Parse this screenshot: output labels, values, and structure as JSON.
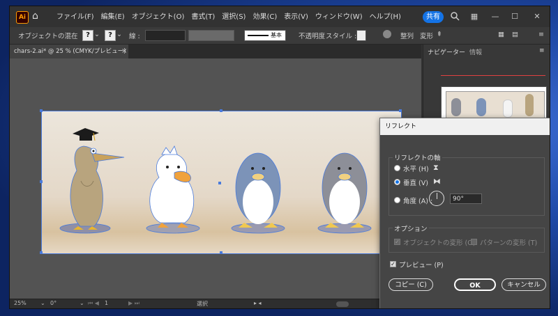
{
  "app": {
    "logo": "Ai",
    "menu": [
      "ファイル(F)",
      "編集(E)",
      "オブジェクト(O)",
      "書式(T)",
      "選択(S)",
      "効果(C)",
      "表示(V)",
      "ウィンドウ(W)",
      "ヘルプ(H)"
    ],
    "share_label": "共有"
  },
  "control_bar": {
    "mixed_label": "オブジェクトの混在",
    "stroke_label": "線 :",
    "stroke_style": "基本",
    "opacity_label": "不透明度",
    "style_label": "スタイル :",
    "align_label": "整列",
    "transform_label": "変形"
  },
  "document": {
    "tab_title": "chars-2.ai* @ 25 % (CMYK/プレビュー)",
    "tab_close": "×"
  },
  "status_bar": {
    "zoom": "25%",
    "rotation": "0°",
    "artboard_index": "1",
    "tool": "選択"
  },
  "panel": {
    "tabs": [
      "ナビゲーター",
      "情報"
    ]
  },
  "reflect_dialog": {
    "title": "リフレクト",
    "axis_group_label": "リフレクトの軸",
    "horizontal_label": "水平 (H)",
    "vertical_label": "垂直 (V)",
    "angle_label": "角度 (A) :",
    "angle_value": "90°",
    "selected_axis": "vertical",
    "options_group_label": "オプション",
    "transform_objects_label": "オブジェクトの変形 (O)",
    "transform_patterns_label": "パターンの変形 (T)",
    "preview_label": "プレビュー (P)",
    "copy_button": "コピー (C)",
    "ok_button": "OK",
    "cancel_button": "キャンセル"
  },
  "colors": {
    "accent": "#1473e6",
    "selection": "#4a7bdc",
    "app_bg": "#323232",
    "canvas_bg": "#535353"
  }
}
